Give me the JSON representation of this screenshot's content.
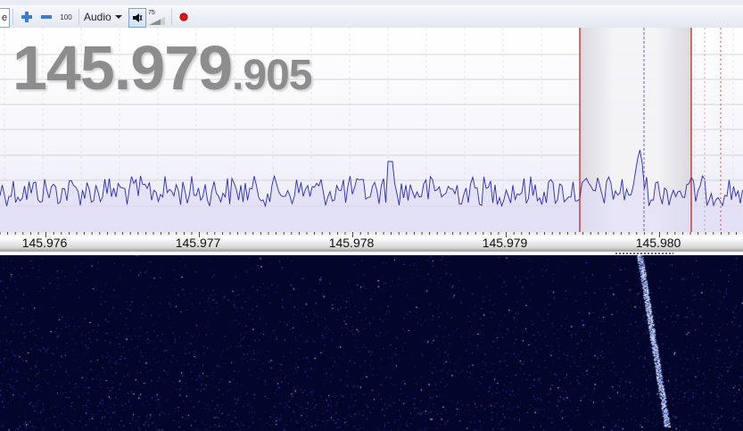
{
  "toolbar": {
    "partial_label": "e",
    "zoom_in_icon": "plus-icon",
    "zoom_out_icon": "minus-icon",
    "zoom_value": "100",
    "audio_label": "Audio",
    "volume_value": "75",
    "mute_icon": "speaker-icon",
    "record_icon": "record-icon",
    "record_color": "#e0141b"
  },
  "display": {
    "frequency_main": "145.979",
    "frequency_fine": ".905"
  },
  "axis": {
    "ticks": [
      "145.976",
      "145.977",
      "145.978",
      "145.979",
      "145.980"
    ]
  },
  "colors": {
    "trace": "#2b2bb0",
    "waterfall_bg": "#03052a",
    "passband_edge": "#c01818",
    "center_line": "#3d46b8"
  }
}
